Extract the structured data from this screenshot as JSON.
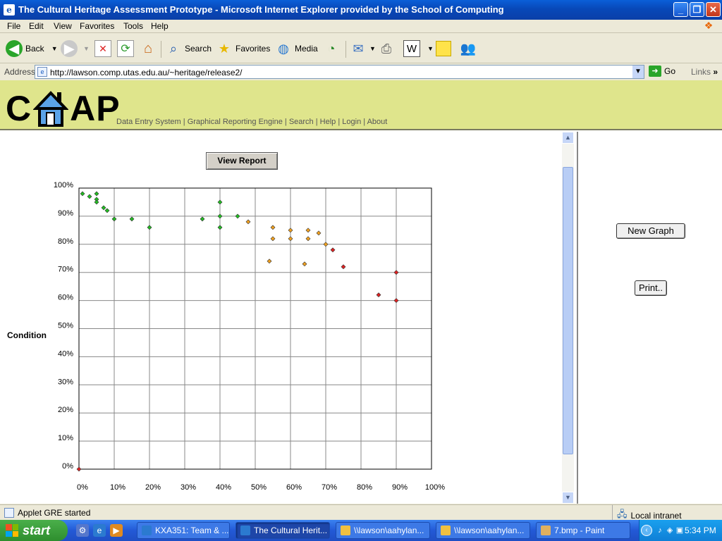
{
  "window": {
    "title": "The Cultural Heritage Assessment Prototype - Microsoft Internet Explorer provided by the School of Computing",
    "controls": [
      "minimize",
      "maximize",
      "close"
    ]
  },
  "menu": [
    "File",
    "Edit",
    "View",
    "Favorites",
    "Tools",
    "Help"
  ],
  "toolbar": {
    "back": "Back",
    "search": "Search",
    "favorites": "Favorites",
    "media": "Media"
  },
  "address": {
    "label": "Address",
    "url": "http://lawson.comp.utas.edu.au/~heritage/release2/",
    "go": "Go",
    "links": "Links"
  },
  "site": {
    "logo_c": "C",
    "logo_ap": "AP",
    "nav": [
      "Data Entry System",
      "Graphical Reporting Engine",
      "Search",
      "Help",
      "Login",
      "About"
    ],
    "nav_sep": " | "
  },
  "report": {
    "view_report": "View Report",
    "new_graph": "New Graph",
    "print": "Print.."
  },
  "chart_data": {
    "type": "scatter",
    "xlabel": "",
    "ylabel": "Condition",
    "xlim": [
      0,
      100
    ],
    "ylim": [
      0,
      100
    ],
    "x_ticks": [
      "0%",
      "10%",
      "20%",
      "30%",
      "40%",
      "50%",
      "60%",
      "70%",
      "80%",
      "90%",
      "100%"
    ],
    "y_ticks": [
      "0%",
      "10%",
      "20%",
      "30%",
      "40%",
      "50%",
      "60%",
      "70%",
      "80%",
      "90%",
      "100%"
    ],
    "grid": true,
    "series": [
      {
        "color": "#22bb22",
        "points": [
          [
            1,
            98
          ],
          [
            3,
            97
          ],
          [
            5,
            98
          ],
          [
            5,
            96
          ],
          [
            5,
            95
          ],
          [
            7,
            93
          ],
          [
            8,
            92
          ],
          [
            10,
            89
          ],
          [
            15,
            89
          ],
          [
            20,
            86
          ],
          [
            35,
            89
          ],
          [
            40,
            95
          ],
          [
            40,
            90
          ],
          [
            40,
            86
          ],
          [
            45,
            90
          ]
        ]
      },
      {
        "color": "#f0a020",
        "points": [
          [
            48,
            88
          ],
          [
            54,
            74
          ],
          [
            55,
            86
          ],
          [
            55,
            82
          ],
          [
            60,
            85
          ],
          [
            60,
            82
          ],
          [
            64,
            73
          ],
          [
            65,
            85
          ],
          [
            65,
            82
          ],
          [
            68,
            84
          ],
          [
            70,
            80
          ]
        ]
      },
      {
        "color": "#dd2222",
        "points": [
          [
            0,
            0
          ],
          [
            72,
            78
          ],
          [
            75,
            72
          ],
          [
            85,
            62
          ],
          [
            90,
            70
          ],
          [
            90,
            60
          ]
        ]
      }
    ]
  },
  "status": {
    "text": "Applet GRE started",
    "zone": "Local intranet"
  },
  "taskbar": {
    "start": "start",
    "tasks": [
      "KXA351: Team & ...",
      "The Cultural Herit...",
      "\\\\lawson\\aahylan...",
      "\\\\lawson\\aahylan...",
      "7.bmp - Paint"
    ],
    "clock": "5:34 PM"
  }
}
